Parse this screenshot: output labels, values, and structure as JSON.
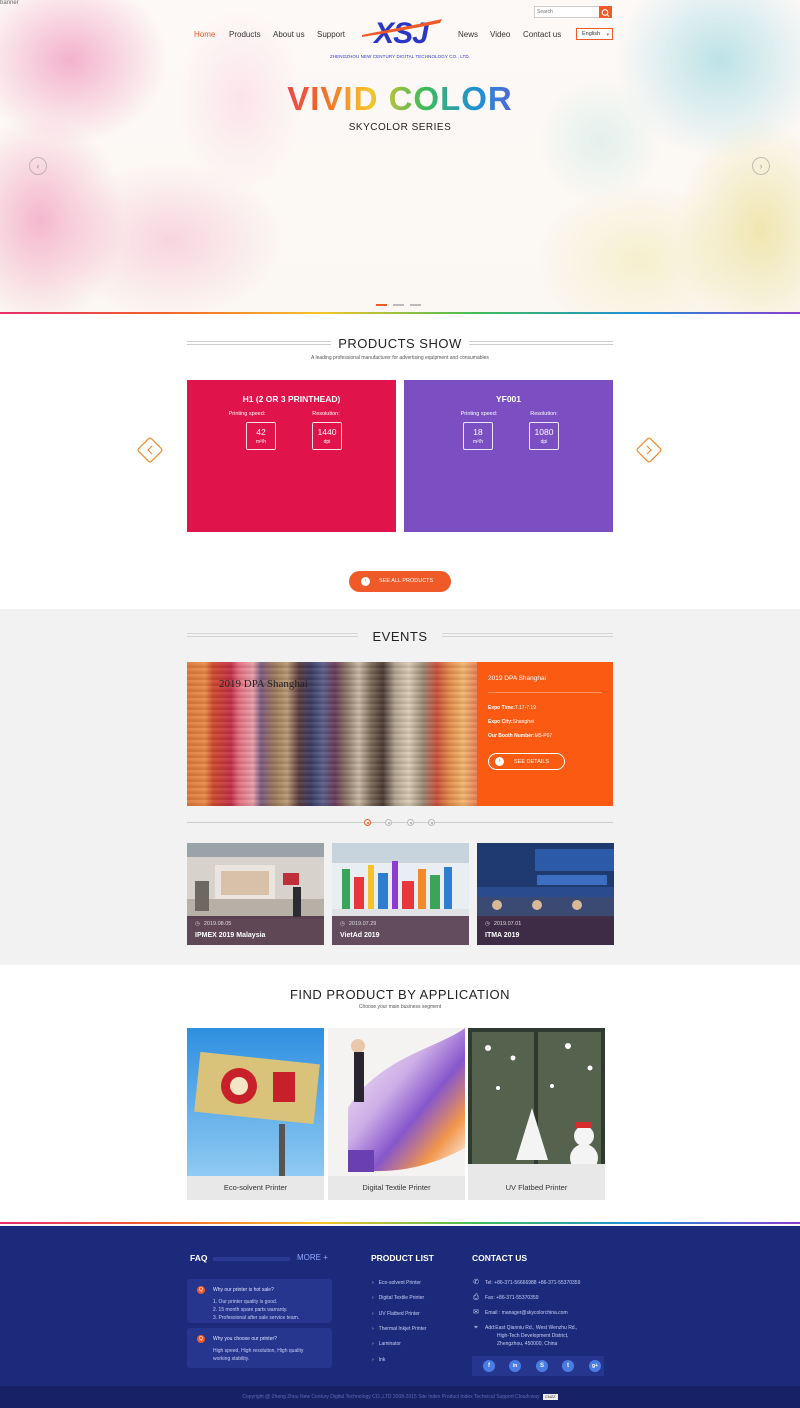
{
  "banner_alt": "banner",
  "nav": {
    "items": [
      "Home",
      "Products",
      "About us",
      "Support",
      "News",
      "Video",
      "Contact us"
    ],
    "active": "Home"
  },
  "logo": {
    "text": "XSJ",
    "subtitle": "ZHENGZHOU NEW CENTURY DIGITAL TECHNOLOGY CO., LTD."
  },
  "search": {
    "placeholder": "Search"
  },
  "language": {
    "selected": "English"
  },
  "hero": {
    "title": "VIVID COLOR",
    "subtitle": "SKYCOLOR SERIES",
    "slide_index": 1,
    "slide_count": 3
  },
  "products": {
    "title": "PRODUCTS SHOW",
    "subtitle": "A leading professional manufacturer for advertising equipment and consumables",
    "cards": [
      {
        "name": "H1 (2 OR 3 PRINTHEAD)",
        "speed_label": "Printing speed:",
        "speed": "42",
        "speed_unit": "m²/h",
        "res_label": "Resolution:",
        "res": "1440",
        "res_unit": "dpi",
        "color": "#e0134a"
      },
      {
        "name": "YF001",
        "speed_label": "Printing speed:",
        "speed": "18",
        "speed_unit": "m²/h",
        "res_label": "Resolution:",
        "res": "1080",
        "res_unit": "dpi",
        "color": "#7b4fc2"
      }
    ],
    "see_all": "SEE ALL PRODUCTS"
  },
  "events": {
    "title": "EVENTS",
    "feature": {
      "image_caption": "2019 DPA Shanghai",
      "title": "2019 DPA Shanghai",
      "time_label": "Expo Time:",
      "time": "7.17-7.19",
      "city_label": "Expo City:",
      "city": "Shanghai",
      "booth_label": "Our Booth Number:",
      "booth": "M5-P07",
      "details": "SEE DETAILS"
    },
    "news": [
      {
        "date": "2019.08.05",
        "title": "IPMEX 2019 Malaysia"
      },
      {
        "date": "2019.07.29",
        "title": "VietAd 2019"
      },
      {
        "date": "2019.07.01",
        "title": "ITMA 2019"
      }
    ]
  },
  "application": {
    "title": "FIND PRODUCT BY APPLICATION",
    "subtitle": "Choose your main business segment",
    "items": [
      "Eco-solvent Printer",
      "Digital Textile Printer",
      "UV Flatbed Printer"
    ]
  },
  "footer": {
    "faq_title": "FAQ",
    "faq_more": "MORE +",
    "faq": [
      {
        "q": "Why our printer is hot sale?",
        "a": [
          "1. Our printer quality is good.",
          "2. 15 month spare parts warranty.",
          "3. Professional after sale service team."
        ]
      },
      {
        "q": "Why you choose our printer?",
        "a": [
          "High speed, High resolution, High quality",
          "working stability."
        ]
      }
    ],
    "product_list_title": "PRODUCT LIST",
    "product_list": [
      "Eco-solvent Printer",
      "Digital Textile Printer",
      "UV Flatbed Printer",
      "Thermal Inkjet Printer",
      "Laminator",
      "Ink"
    ],
    "contact_title": "CONTACT US",
    "tel": "Tel: +86-371-56666988 +86-371-55370359",
    "fax": "Fax: +86-371-55370359",
    "email": "Email : manager@skycolorchina.com",
    "address": [
      "Add:East Qianniu Rd., West Wenzhu Rd.,",
      "High-Tech Development District,",
      "Zhengzhou, 450000, China"
    ],
    "social": [
      "f",
      "in",
      "S",
      "t",
      "g+"
    ]
  },
  "copyright": {
    "text": "Copyright @ Zheng Zhou New Century Digital Technology CO.,LTD 2008-2015 Site Index Product Index Technical Support:Cloudcway",
    "badge": "CNZZ"
  }
}
